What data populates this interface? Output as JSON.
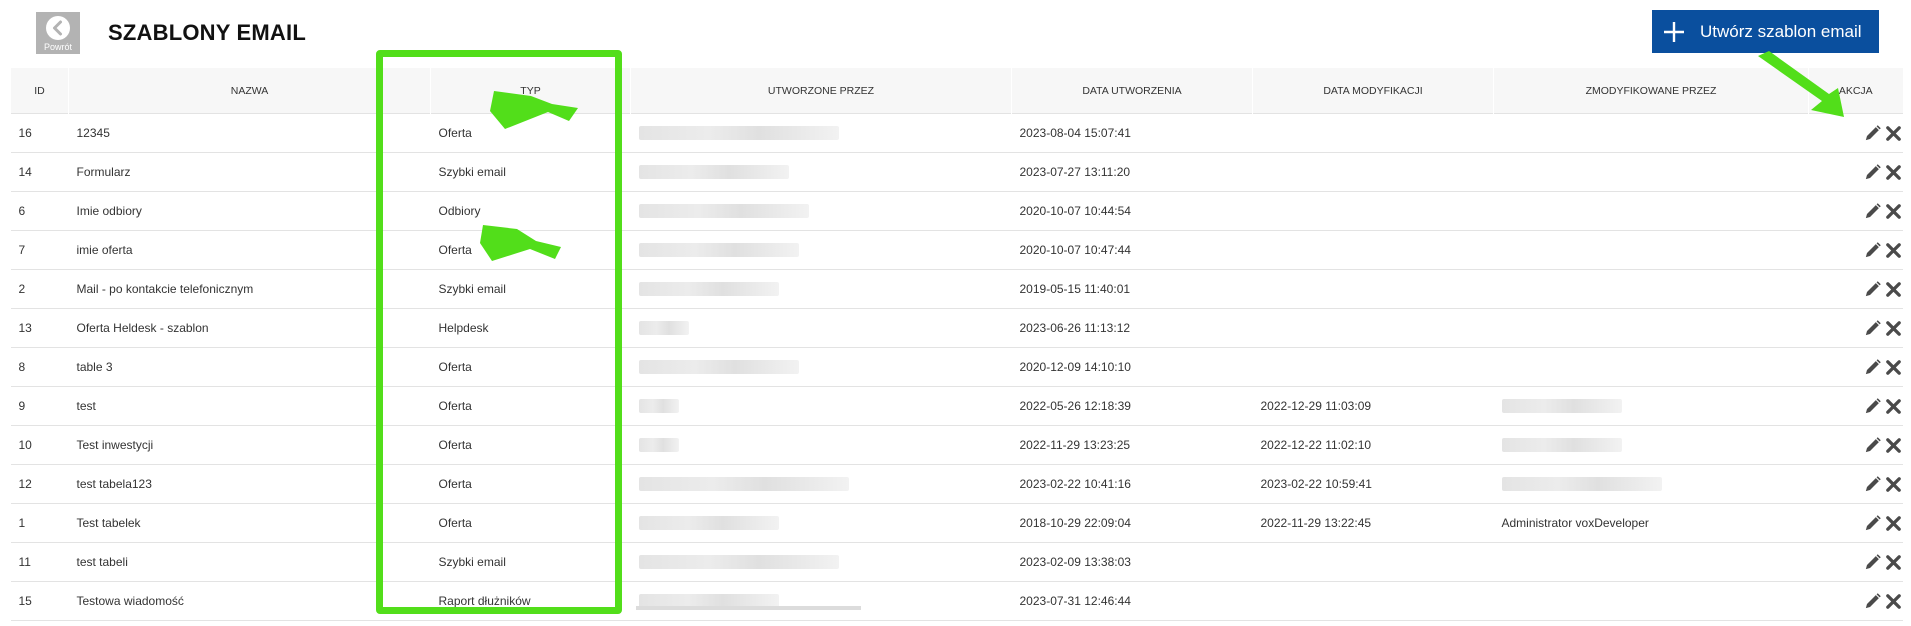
{
  "header": {
    "back_label": "Powrót",
    "title": "SZABLONY EMAIL",
    "create_label": "Utwórz szablon email"
  },
  "table": {
    "columns": {
      "id": "ID",
      "name": "NAZWA",
      "type": "TYP",
      "created_by": "UTWORZONE PRZEZ",
      "created_at": "DATA UTWORZENIA",
      "modified_at": "DATA MODYFIKACJI",
      "modified_by": "ZMODYFIKOWANE PRZEZ",
      "action": "AKCJA"
    },
    "rows": [
      {
        "id": "16",
        "name": "12345",
        "type": "Oferta",
        "created_at": "2023-08-04 15:07:41",
        "modified_at": "",
        "modified_by": ""
      },
      {
        "id": "14",
        "name": "Formularz",
        "type": "Szybki email",
        "created_at": "2023-07-27 13:11:20",
        "modified_at": "",
        "modified_by": ""
      },
      {
        "id": "6",
        "name": "Imie odbiory",
        "type": "Odbiory",
        "created_at": "2020-10-07 10:44:54",
        "modified_at": "",
        "modified_by": ""
      },
      {
        "id": "7",
        "name": "imie oferta",
        "type": "Oferta",
        "created_at": "2020-10-07 10:47:44",
        "modified_at": "",
        "modified_by": ""
      },
      {
        "id": "2",
        "name": "Mail - po kontakcie telefonicznym",
        "type": "Szybki email",
        "created_at": "2019-05-15 11:40:01",
        "modified_at": "",
        "modified_by": ""
      },
      {
        "id": "13",
        "name": "Oferta Heldesk - szablon",
        "type": "Helpdesk",
        "created_at": "2023-06-26 11:13:12",
        "modified_at": "",
        "modified_by": ""
      },
      {
        "id": "8",
        "name": "table 3",
        "type": "Oferta",
        "created_at": "2020-12-09 14:10:10",
        "modified_at": "",
        "modified_by": ""
      },
      {
        "id": "9",
        "name": "test",
        "type": "Oferta",
        "created_at": "2022-05-26 12:18:39",
        "modified_at": "2022-12-29 11:03:09",
        "modified_by": ""
      },
      {
        "id": "10",
        "name": "Test inwestycji",
        "type": "Oferta",
        "created_at": "2022-11-29 13:23:25",
        "modified_at": "2022-12-22 11:02:10",
        "modified_by": ""
      },
      {
        "id": "12",
        "name": "test tabela123",
        "type": "Oferta",
        "created_at": "2023-02-22 10:41:16",
        "modified_at": "2023-02-22 10:59:41",
        "modified_by": ""
      },
      {
        "id": "1",
        "name": "Test tabelek",
        "type": "Oferta",
        "created_at": "2018-10-29 22:09:04",
        "modified_at": "2022-11-29 13:22:45",
        "modified_by": "Administrator voxDeveloper"
      },
      {
        "id": "11",
        "name": "test tabeli",
        "type": "Szybki email",
        "created_at": "2023-02-09 13:38:03",
        "modified_at": "",
        "modified_by": ""
      },
      {
        "id": "15",
        "name": "Testowa wiadomość",
        "type": "Raport dłużników",
        "created_at": "2023-07-31 12:46:44",
        "modified_at": "",
        "modified_by": ""
      }
    ]
  },
  "icons": {
    "back": "arrow-left-circle-icon",
    "create": "plus-icon",
    "edit": "pencil-icon",
    "delete": "close-x-icon"
  },
  "colors": {
    "accent": "#0a4f9e",
    "highlight": "#52de1a",
    "header_bg": "#f7f7f7",
    "back_button": "#b3b3b3"
  }
}
